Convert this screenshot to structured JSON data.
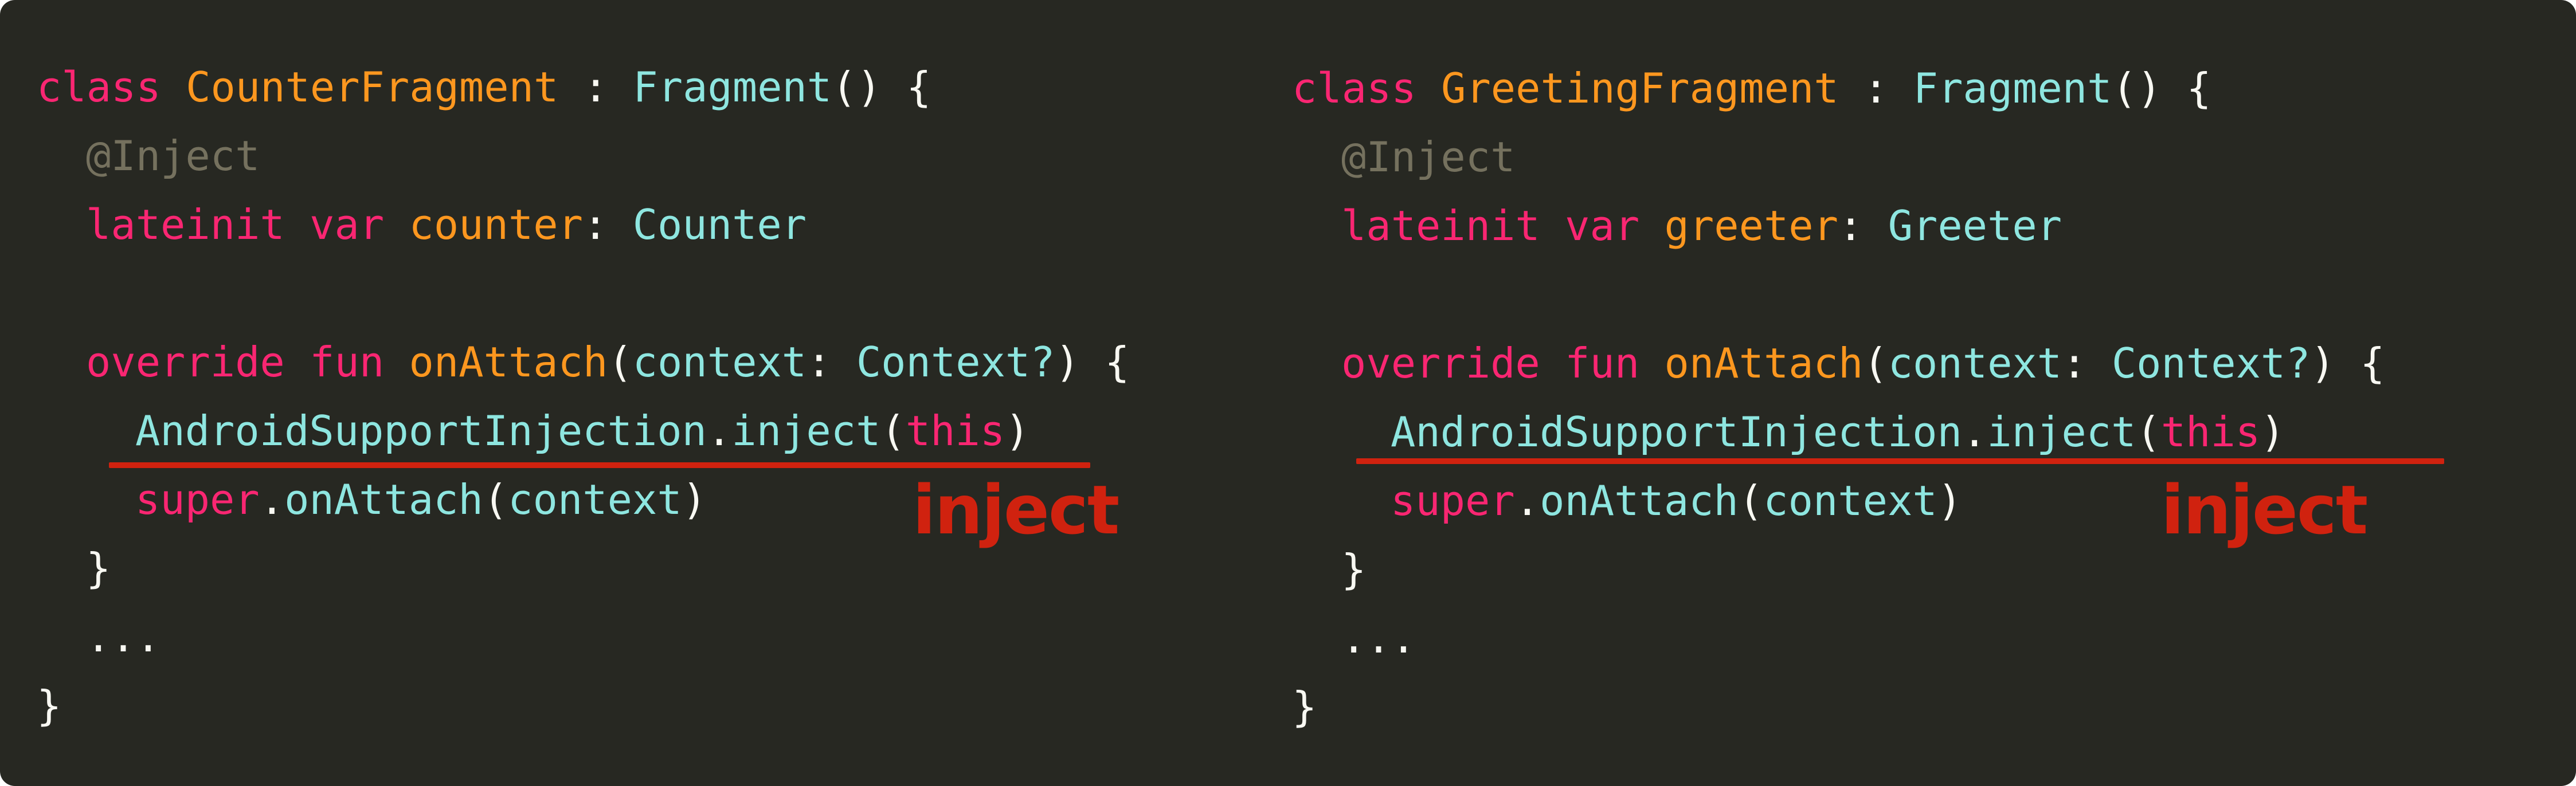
{
  "left": {
    "line1": {
      "kw": "class",
      "name": "CounterFragment",
      "sep": " : ",
      "base": "Fragment",
      "tail": "() {"
    },
    "line2": {
      "ann": "@Inject"
    },
    "line3": {
      "kw1": "lateinit",
      "kw2": "var",
      "prop": "counter",
      "colon": ": ",
      "type": "Counter"
    },
    "line5": {
      "kw1": "override",
      "kw2": "fun",
      "fn": "onAttach",
      "open": "(",
      "param": "context",
      "colon": ": ",
      "type": "Context?",
      "close": ") {"
    },
    "line6": {
      "obj": "AndroidSupportInjection",
      "dot": ".",
      "fn": "inject",
      "open": "(",
      "arg": "this",
      "close": ")"
    },
    "line7": {
      "kw": "super",
      "dot": ".",
      "fn": "onAttach",
      "open": "(",
      "arg": "context",
      "close": ")"
    },
    "line8": {
      "text": "}"
    },
    "line9": {
      "text": "..."
    },
    "line10": {
      "text": "}"
    },
    "badge": "inject"
  },
  "right": {
    "line1": {
      "kw": "class",
      "name": "GreetingFragment",
      "sep": " : ",
      "base": "Fragment",
      "tail": "() {"
    },
    "line2": {
      "ann": "@Inject"
    },
    "line3": {
      "kw1": "lateinit",
      "kw2": "var",
      "prop": "greeter",
      "colon": ": ",
      "type": "Greeter"
    },
    "line5": {
      "kw1": "override",
      "kw2": "fun",
      "fn": "onAttach",
      "open": "(",
      "param": "context",
      "colon": ": ",
      "type": "Context?",
      "close": ") {"
    },
    "line6": {
      "obj": "AndroidSupportInjection",
      "dot": ".",
      "fn": "inject",
      "open": "(",
      "arg": "this",
      "close": ")"
    },
    "line7": {
      "kw": "super",
      "dot": ".",
      "fn": "onAttach",
      "open": "(",
      "arg": "context",
      "close": ")"
    },
    "line8": {
      "text": "}"
    },
    "line9": {
      "text": "..."
    },
    "line10": {
      "text": "}"
    },
    "badge": "inject"
  },
  "colors": {
    "background": "#272822",
    "keyword": "#f92672",
    "class_name": "#fd971f",
    "type": "#8ee6e0",
    "annotation": "#75715e",
    "plain": "#f8f8f2",
    "highlight": "#d0220f"
  }
}
